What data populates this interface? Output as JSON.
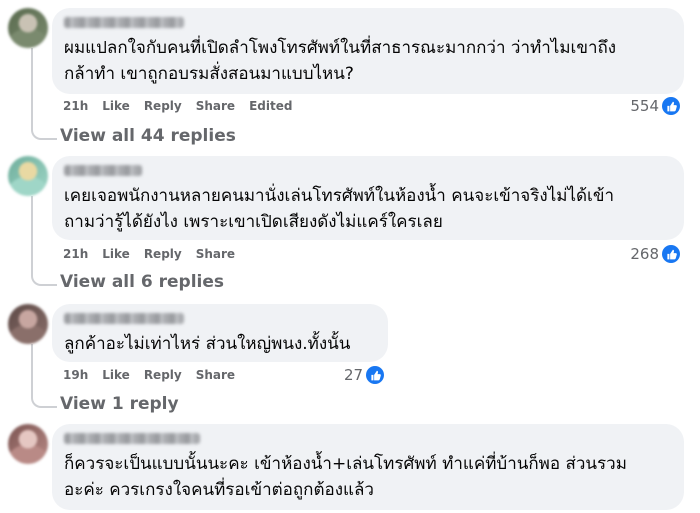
{
  "comments": [
    {
      "text": "ผมแปลกใจกับคนที่เปิดลำโพงโทรศัพท์ในที่สาธารณะมากกว่า ว่าทำไมเขาถึง\nกล้าทำ เขาถูกอบรมสั่งสอนมาแบบไหน?",
      "time": "21h",
      "like": "Like",
      "reply": "Reply",
      "share": "Share",
      "edited": "Edited",
      "reactions": "554",
      "view_replies": "View all 44 replies",
      "avatar_colors": [
        "#7a8a6e",
        "#c9c2b4",
        "#5a6b4f"
      ]
    },
    {
      "text": "เคยเจอพนักงานหลายคนมานั่งเล่นโทรศัพท์ในห้องน้ำ คนจะเข้าจริงไม่ได้เข้า\nถามว่ารู้ได้ยังไง เพราะเขาเปิดเสียงดังไม่แคร์ใครเลย",
      "time": "21h",
      "like": "Like",
      "reply": "Reply",
      "share": "Share",
      "reactions": "268",
      "view_replies": "View all 6 replies",
      "avatar_colors": [
        "#9fd6c7",
        "#e9d9a3",
        "#6fae9c"
      ]
    },
    {
      "text": "ลูกค้าอะไม่เท่าไหร่ ส่วนใหญ่พนง.ทั้งนั้น",
      "time": "19h",
      "like": "Like",
      "reply": "Reply",
      "share": "Share",
      "reactions": "27",
      "view_replies": "View 1 reply",
      "avatar_colors": [
        "#8a6f6a",
        "#c7a6a0",
        "#5e4a47"
      ]
    },
    {
      "text": "ก็ควรจะเป็นแบบนั้นนะคะ เข้าห้องน้ำ+เล่นโทรศัพท์ ทำแค่ที่บ้านก็พอ ส่วนรวม\nอะค่ะ ควรเกรงใจคนที่รอเข้าต่อถูกต้องแล้ว",
      "avatar_colors": [
        "#b98a86",
        "#e5c7c2",
        "#7c5552"
      ]
    }
  ],
  "colors": {
    "like_blue": "#1877f2",
    "bubble": "#f0f2f5",
    "meta_gray": "#65676b"
  }
}
